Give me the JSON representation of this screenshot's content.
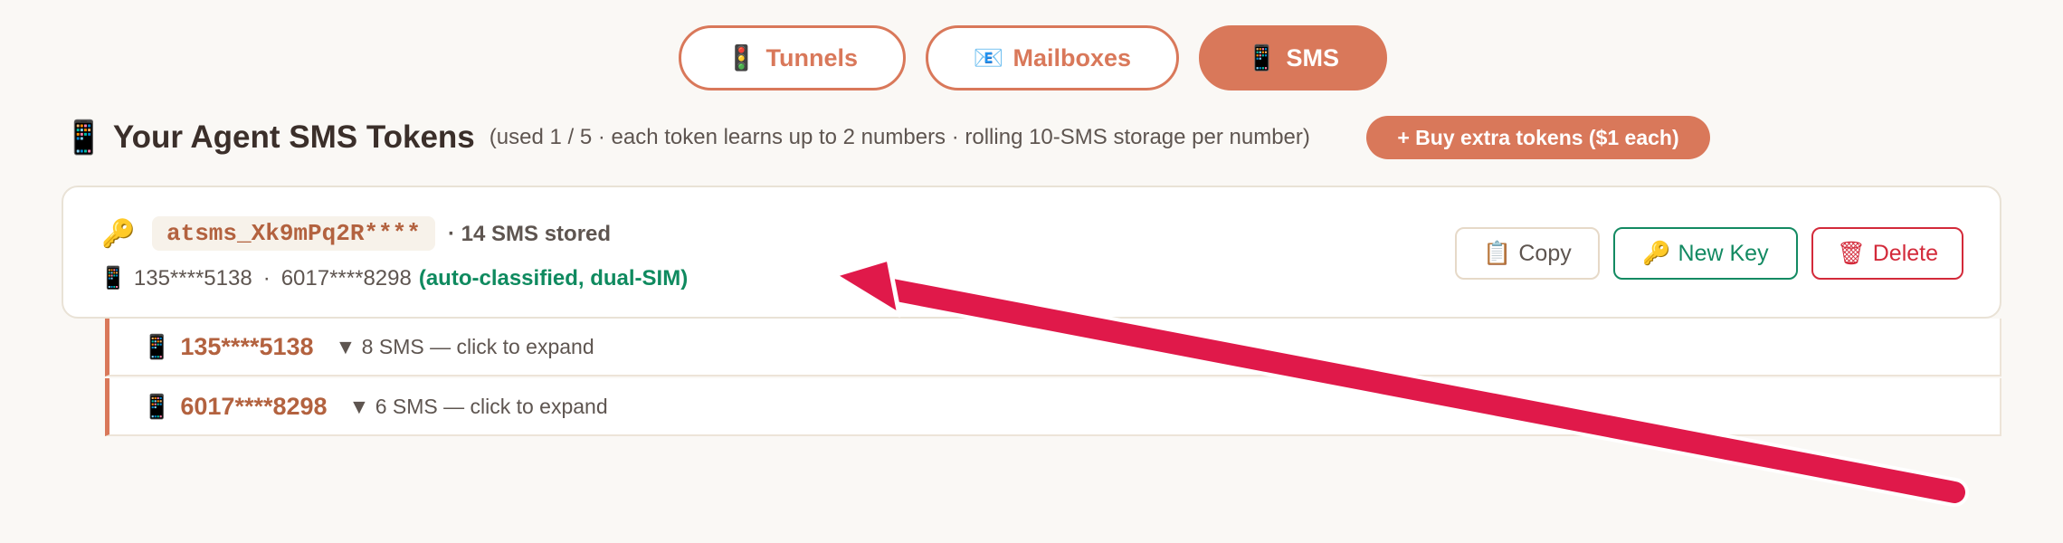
{
  "tabs": [
    {
      "icon": "🚦",
      "label": "Tunnels",
      "active": false
    },
    {
      "icon": "📧",
      "label": "Mailboxes",
      "active": false
    },
    {
      "icon": "📱",
      "label": "SMS",
      "active": true
    }
  ],
  "heading": {
    "icon": "📱",
    "title": "Your Agent SMS Tokens",
    "note": "(used 1 / 5 · each token learns up to 2 numbers · rolling 10-SMS storage per number)",
    "buy_button_label": "+ Buy extra tokens ($1 each)"
  },
  "token": {
    "key_icon": "🔑",
    "code": "atsms_Xk9mPq2R****",
    "stored": "· 14 SMS stored",
    "phone_icon": "📱",
    "number_1": "135****5138",
    "separator": "·",
    "number_2": "6017****8298",
    "classification": "(auto-classified, dual-SIM)",
    "actions": {
      "copy_icon": "📋",
      "copy_label": "Copy",
      "newkey_icon": "🔑",
      "newkey_label": "New Key",
      "delete_icon": "🗑",
      "delete_label": "Delete"
    }
  },
  "numbers": [
    {
      "icon": "📱",
      "number": "135****5138",
      "expand": "▼ 8 SMS — click to expand"
    },
    {
      "icon": "📱",
      "number": "6017****8298",
      "expand": "▼ 6 SMS — click to expand"
    }
  ],
  "colors": {
    "accent": "#d9785a",
    "success": "#138a62",
    "danger": "#d32a3a",
    "annotation": "#e0194a"
  }
}
